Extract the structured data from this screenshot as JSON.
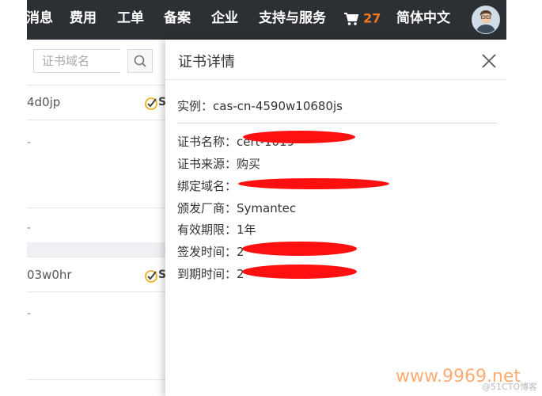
{
  "topbar": {
    "nav": [
      {
        "label": "消息"
      },
      {
        "label": "费用"
      },
      {
        "label": "工单"
      },
      {
        "label": "备案"
      },
      {
        "label": "企业"
      },
      {
        "label": "支持与服务"
      }
    ],
    "cart_count": "27",
    "language": "简体中文",
    "colors": {
      "background": "#2c2f33",
      "cart_accent": "#f37b1d"
    }
  },
  "left_panel": {
    "search_placeholder": "证书域名",
    "rows": [
      {
        "id": "4d0jp",
        "status": "S"
      },
      {
        "id": "03w0hr",
        "status": "S"
      }
    ],
    "dash": "-"
  },
  "drawer": {
    "title": "证书详情",
    "instance": "实例：cas-cn-4590w10680js",
    "details": [
      {
        "label": "证书名称：",
        "value": "cert-1019",
        "redacted": true
      },
      {
        "label": "证书来源：",
        "value": "购买",
        "redacted": false
      },
      {
        "label": "绑定域名：",
        "value": "",
        "redacted": true
      },
      {
        "label": "颁发厂商：",
        "value": "Symantec",
        "redacted": false
      },
      {
        "label": "有效期限：",
        "value": "1年",
        "redacted": false
      },
      {
        "label": "签发时间：",
        "value": "2",
        "redacted": true
      },
      {
        "label": "到期时间：",
        "value": "2",
        "redacted": true
      }
    ],
    "redaction_color": "#ff1010"
  },
  "watermark": {
    "text": "www.9969.net",
    "small": "@51CTO博客"
  }
}
